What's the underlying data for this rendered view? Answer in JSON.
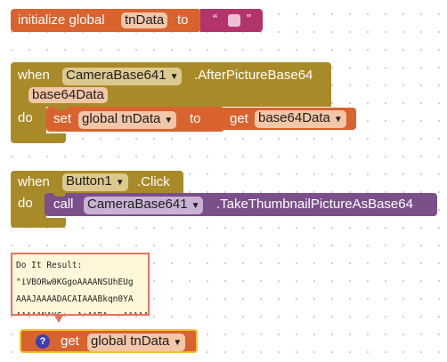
{
  "colors": {
    "variables_block": "#d8632e",
    "event_block": "#a98a28",
    "method_block": "#7b4f8a",
    "text_block": "#b3336b",
    "comment_border": "#e6735f"
  },
  "init_block": {
    "keyword": "initialize global",
    "var_name": "tnData",
    "to_label": "to",
    "quote_open": "“",
    "quote_close": "”",
    "text_value": ""
  },
  "camera_event": {
    "when_label": "when",
    "component": "CameraBase641",
    "event": ".AfterPictureBase64",
    "param": "base64Data",
    "do_label": "do",
    "set_label": "set",
    "set_var": "global tnData",
    "to_label": "to",
    "get_label": "get",
    "get_var": "base64Data"
  },
  "button_event": {
    "when_label": "when",
    "component": "Button1",
    "event": ".Click",
    "do_label": "do",
    "call_label": "call",
    "call_component": "CameraBase641",
    "call_method": ".TakeThumbnailPictureAsBase64"
  },
  "do_it_result": {
    "title": "Do It Result:",
    "line1": "\"iVBORw0KGgoAAAANSUhEUg",
    "line2": "AAAJAAAADACAIAAABkqn0YA",
    "line3": "AAAAANAKG+..AsAABA...AAAAA"
  },
  "get_block": {
    "help_glyph": "?",
    "get_label": "get",
    "var_name": "global tnData"
  },
  "icons": {
    "dropdown": "dropdown-arrow-icon",
    "help": "question-mark-icon"
  }
}
